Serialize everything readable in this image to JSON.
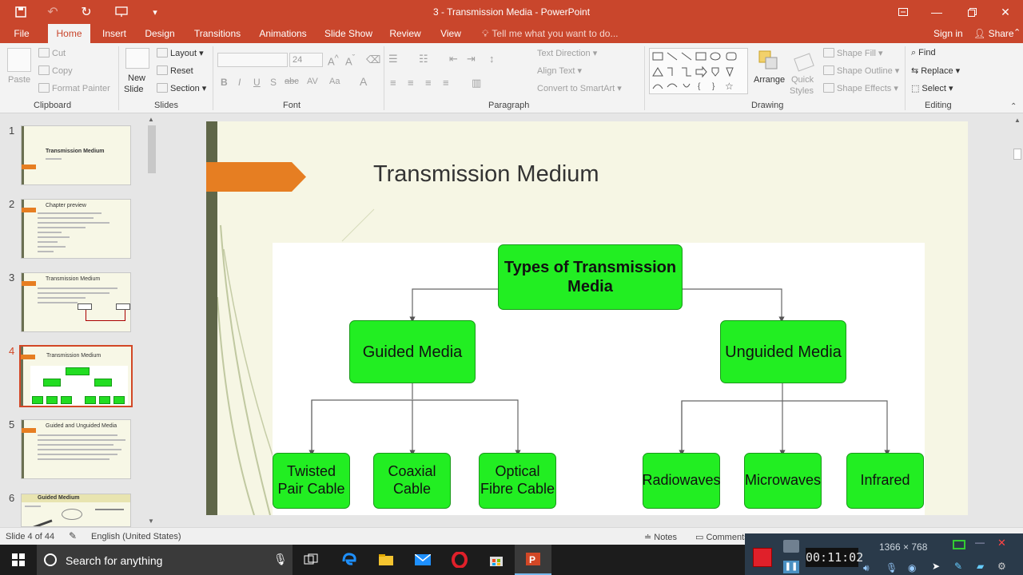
{
  "window": {
    "title": "3 - Transmission Media - PowerPoint"
  },
  "tabs": [
    {
      "label": "File"
    },
    {
      "label": "Home"
    },
    {
      "label": "Insert"
    },
    {
      "label": "Design"
    },
    {
      "label": "Transitions"
    },
    {
      "label": "Animations"
    },
    {
      "label": "Slide Show"
    },
    {
      "label": "Review"
    },
    {
      "label": "View"
    }
  ],
  "tellme": "Tell me what you want to do...",
  "account": {
    "signin": "Sign in",
    "share": "Share"
  },
  "ribbon": {
    "clipboard": {
      "label": "Clipboard",
      "paste": "Paste",
      "cut": "Cut",
      "copy": "Copy",
      "format_painter": "Format Painter"
    },
    "slides": {
      "label": "Slides",
      "new_slide": "New",
      "new_slide2": "Slide",
      "layout": "Layout",
      "reset": "Reset",
      "section": "Section"
    },
    "font": {
      "label": "Font",
      "size": "24"
    },
    "paragraph": {
      "label": "Paragraph",
      "text_direction": "Text Direction",
      "align_text": "Align Text",
      "convert": "Convert to SmartArt"
    },
    "drawing": {
      "label": "Drawing",
      "arrange": "Arrange",
      "quick_styles": "Quick",
      "quick_styles2": "Styles",
      "shape_fill": "Shape Fill",
      "shape_outline": "Shape Outline",
      "shape_effects": "Shape Effects"
    },
    "editing": {
      "label": "Editing",
      "find": "Find",
      "replace": "Replace",
      "select": "Select"
    }
  },
  "thumbnails": [
    {
      "num": "1",
      "title": "Transmission Medium"
    },
    {
      "num": "2",
      "title": "Chapter preview"
    },
    {
      "num": "3",
      "title": "Transmission Medium"
    },
    {
      "num": "4",
      "title": "Transmission Medium"
    },
    {
      "num": "5",
      "title": "Guided and Unguided Media"
    },
    {
      "num": "6",
      "title": "Guided Medium"
    }
  ],
  "slide": {
    "title": "Transmission Medium",
    "diagram": {
      "root": "Types of Transmission Media",
      "guided": "Guided Media",
      "unguided": "Unguided Media",
      "guided_children": [
        "Twisted Pair Cable",
        "Coaxial Cable",
        "Optical Fibre Cable"
      ],
      "unguided_children": [
        "Radiowaves",
        "Microwaves",
        "Infrared"
      ]
    }
  },
  "status": {
    "slide_of": "Slide 4 of 44",
    "language": "English (United States)",
    "notes": "Notes",
    "comments": "Comments"
  },
  "taskbar": {
    "search_placeholder": "Search for anything",
    "resolution": "1366 × 768",
    "timer": "00:11:02"
  },
  "colors": {
    "accent": "#c9462c",
    "node_fill": "#22ee22",
    "orange_arrow": "#e67e22"
  }
}
